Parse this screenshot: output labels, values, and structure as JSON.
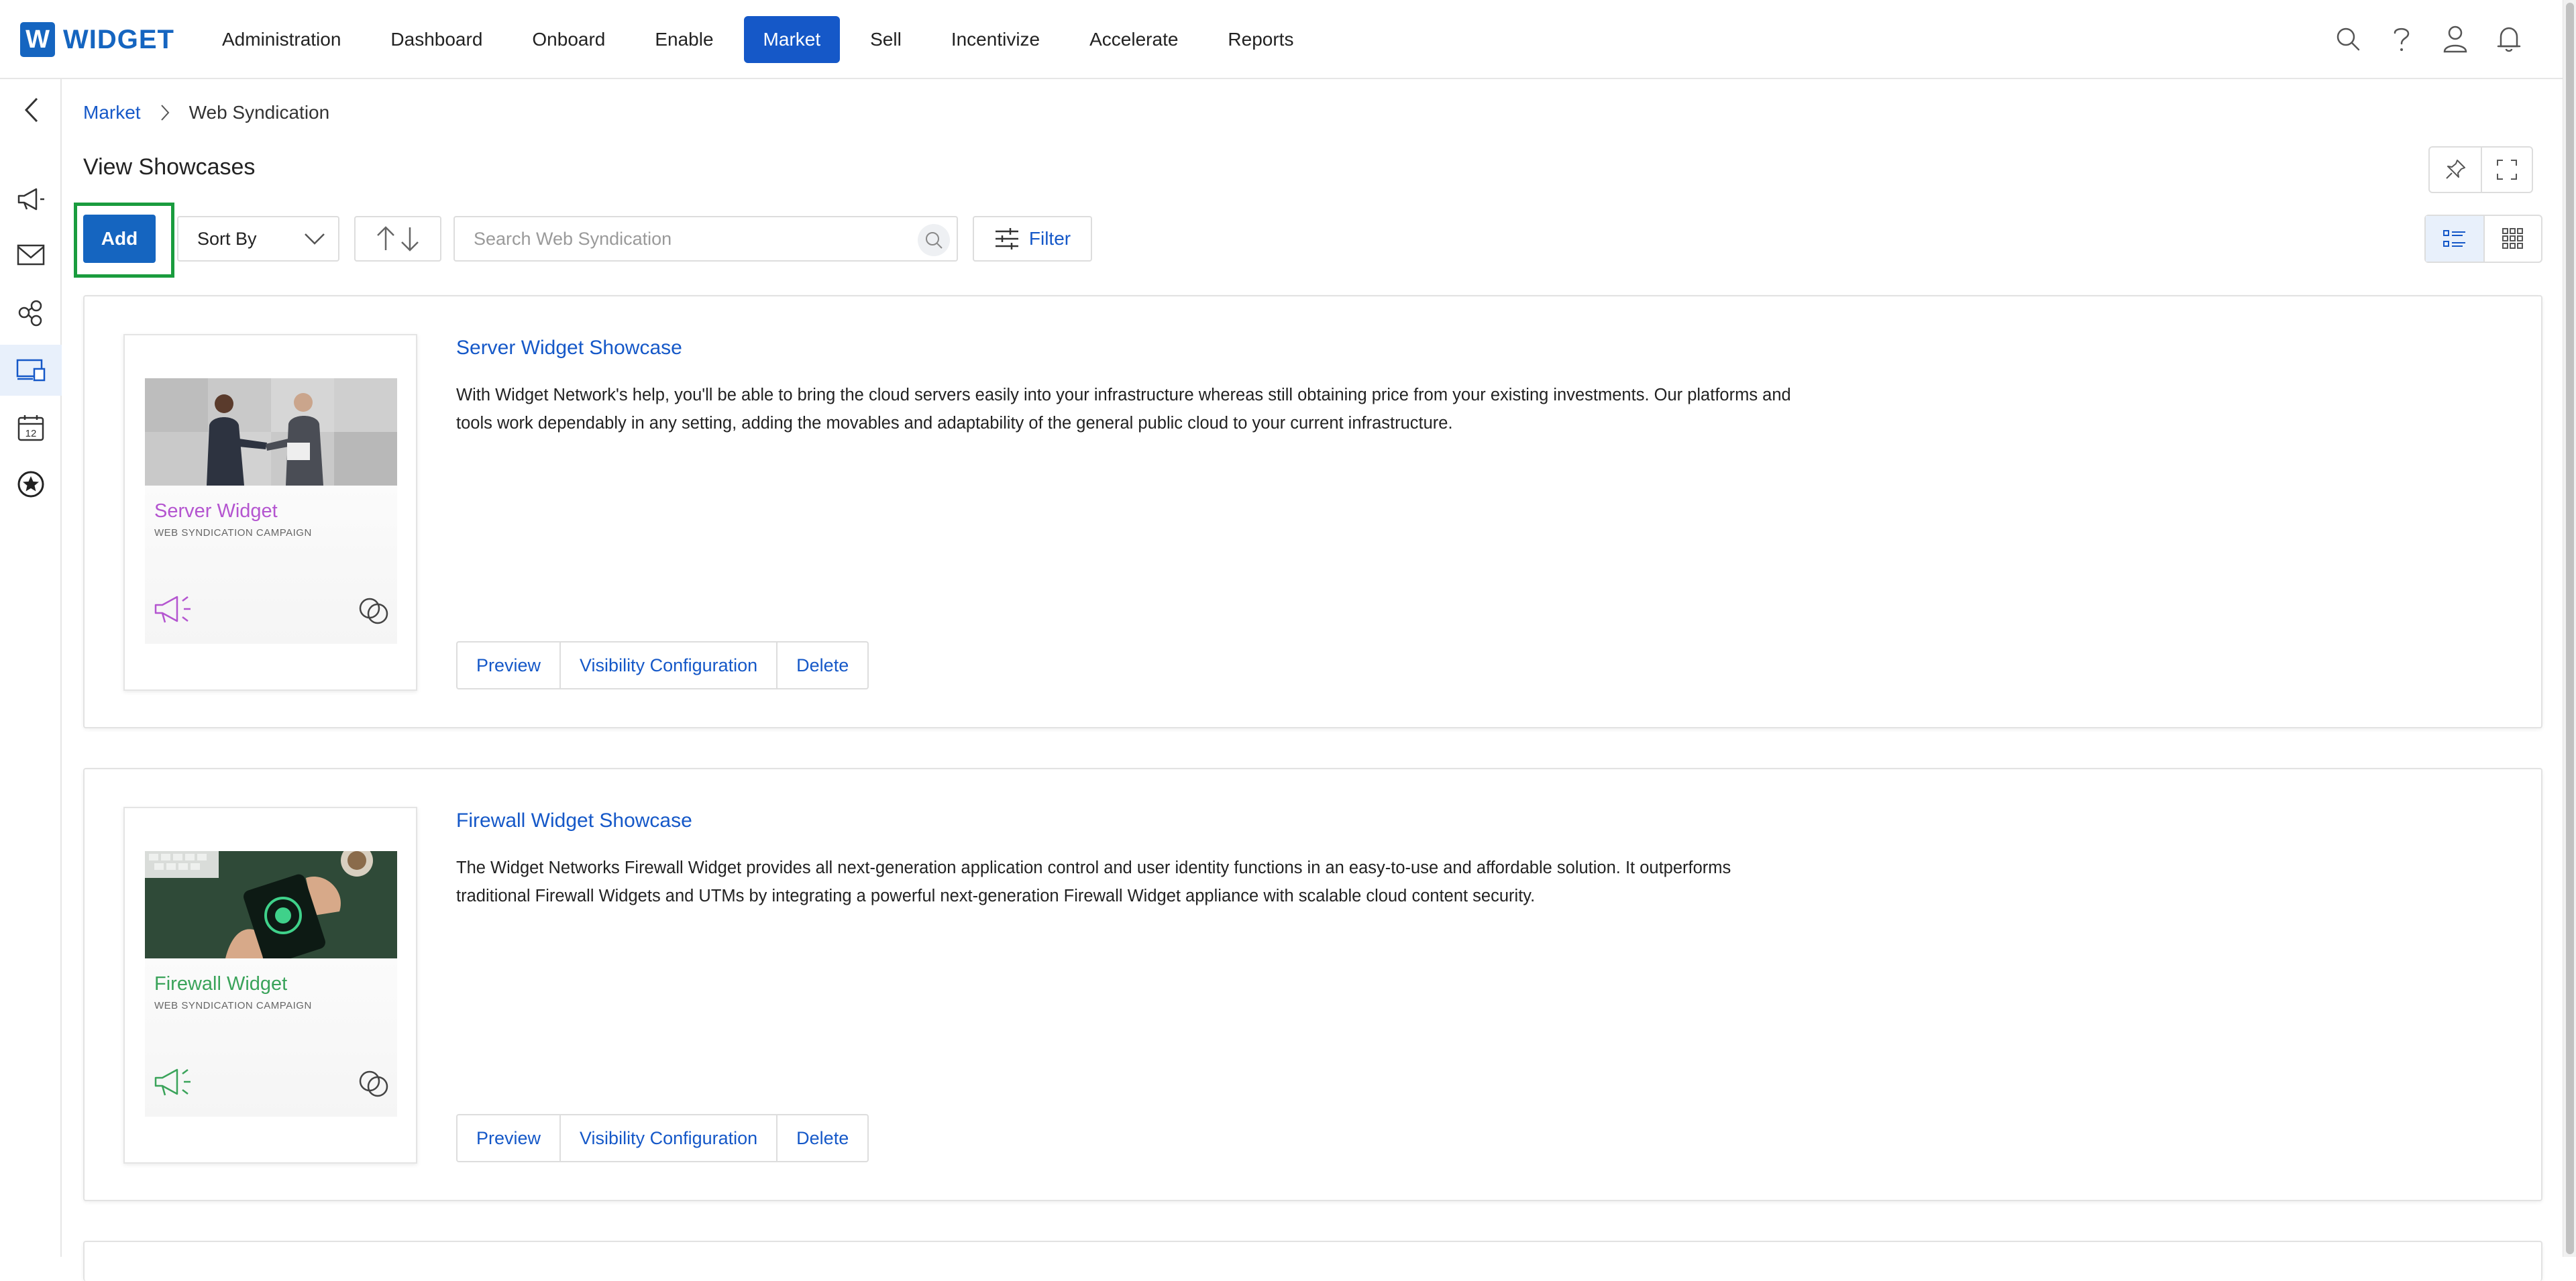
{
  "app": {
    "logo_letter": "W",
    "logo_text": "WIDGET"
  },
  "nav": {
    "items": [
      {
        "label": "Administration"
      },
      {
        "label": "Dashboard"
      },
      {
        "label": "Onboard"
      },
      {
        "label": "Enable"
      },
      {
        "label": "Market",
        "active": true
      },
      {
        "label": "Sell"
      },
      {
        "label": "Incentivize"
      },
      {
        "label": "Accelerate"
      },
      {
        "label": "Reports"
      }
    ]
  },
  "top_icons": [
    "search-icon",
    "help-icon",
    "user-icon",
    "bell-icon"
  ],
  "sidebar": {
    "items": [
      "collapse-chevron-icon",
      "megaphone-icon",
      "mail-icon",
      "share-icon",
      "web-syndication-icon",
      "calendar-icon",
      "star-badge-icon"
    ],
    "calendar_day": "12",
    "active_item": "web-syndication-icon"
  },
  "breadcrumb": {
    "root": "Market",
    "current": "Web Syndication"
  },
  "page": {
    "title": "View Showcases"
  },
  "toolbar": {
    "add_label": "Add",
    "sort_label": "Sort By",
    "search_placeholder": "Search Web Syndication",
    "filter_label": "Filter"
  },
  "colors": {
    "accent": "#1558c8",
    "highlight": "#1a9c3e",
    "server_theme": "#b455d0",
    "firewall_theme": "#3aa35a"
  },
  "showcases": [
    {
      "title": "Server Widget Showcase",
      "description": "With Widget Network's help, you'll be able to bring the cloud servers easily into your infrastructure whereas still obtaining price from your existing investments. Our platforms and tools work dependably in any setting, adding the movables and adaptability of the general public cloud to your current infrastructure.",
      "thumb_title": "Server Widget",
      "thumb_subtitle": "WEB SYNDICATION CAMPAIGN",
      "actions": [
        "Preview",
        "Visibility Configuration",
        "Delete"
      ]
    },
    {
      "title": "Firewall Widget Showcase",
      "description": "The Widget Networks Firewall Widget provides all next-generation application control and user identity functions in an easy-to-use and affordable solution. It outperforms traditional Firewall Widgets and UTMs by integrating a powerful next-generation Firewall Widget appliance with scalable cloud content security.",
      "thumb_title": "Firewall Widget",
      "thumb_subtitle": "WEB SYNDICATION CAMPAIGN",
      "actions": [
        "Preview",
        "Visibility Configuration",
        "Delete"
      ]
    }
  ]
}
